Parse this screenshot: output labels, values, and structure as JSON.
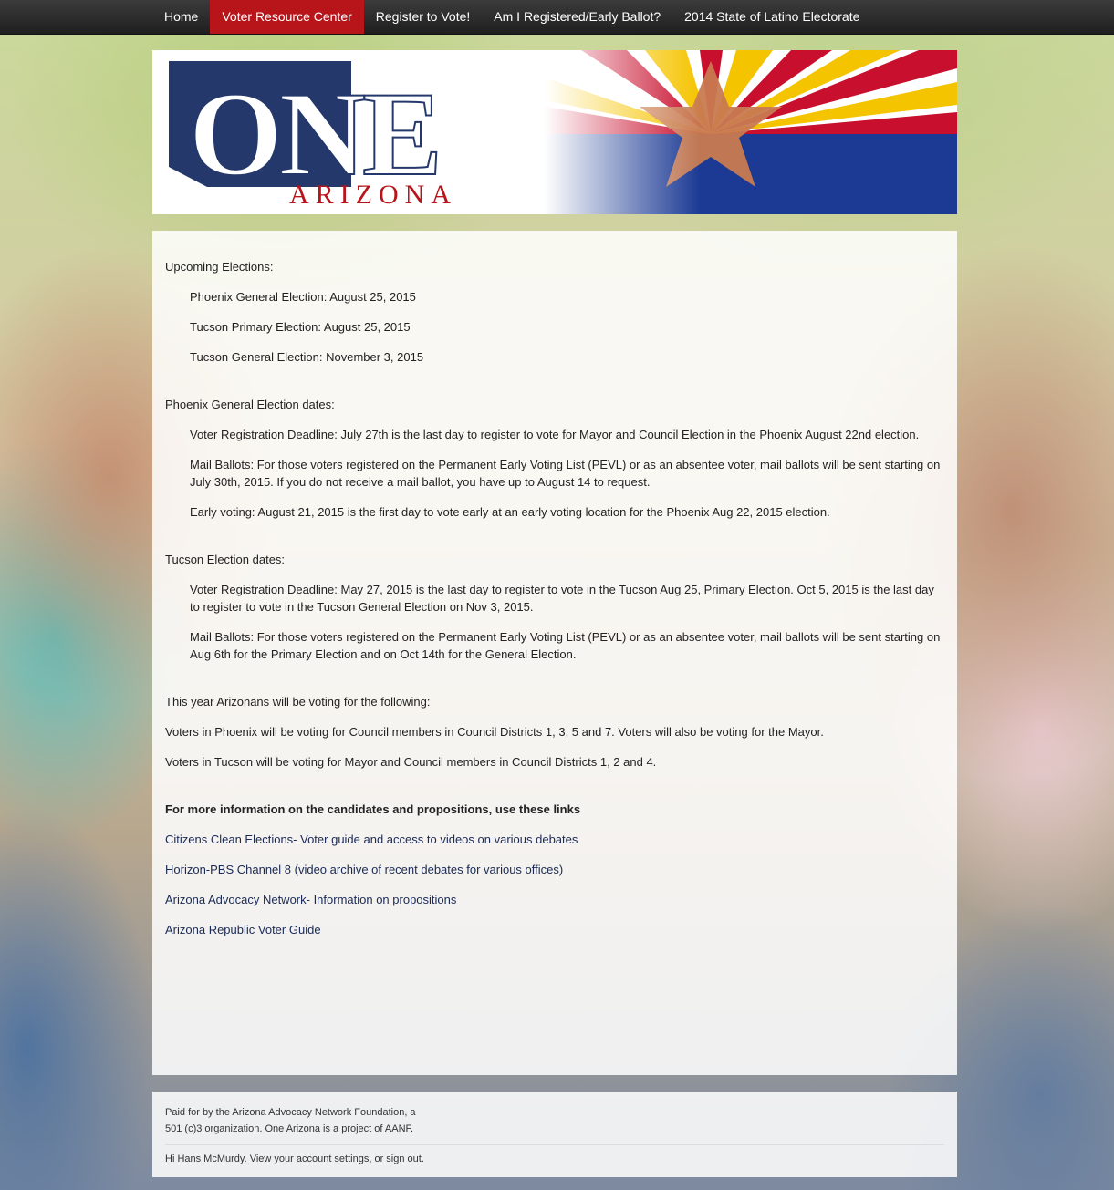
{
  "nav": {
    "items": [
      {
        "label": "Home",
        "active": false
      },
      {
        "label": "Voter Resource Center",
        "active": true
      },
      {
        "label": "Register to Vote!",
        "active": false
      },
      {
        "label": "Am I Registered/Early Ballot?",
        "active": false
      },
      {
        "label": "2014 State of Latino Electorate",
        "active": false
      }
    ],
    "active_color": "#b8151b"
  },
  "banner": {
    "logo_main": "ONE",
    "logo_sub": "ARIZONA",
    "logo_color": "#24386b",
    "sub_color": "#b8151b",
    "flag_colors": {
      "red": "#c8102e",
      "yellow": "#f5c400",
      "blue": "#1c3a94",
      "copper": "#c87a50"
    }
  },
  "content": {
    "upcoming_heading": "Upcoming Elections:",
    "upcoming": [
      "Phoenix General Election:  August 25, 2015",
      "Tucson Primary Election: August 25, 2015",
      "Tucson General Election: November 3, 2015"
    ],
    "phoenix_heading": "Phoenix General Election dates:",
    "phoenix": [
      "Voter Registration Deadline: July 27th is the last day to register to vote for Mayor and Council Election in the Phoenix August  22nd election.",
      "Mail Ballots: For those voters registered on the Permanent Early Voting List (PEVL) or as an absentee voter, mail ballots will be sent starting on July 30th, 2015.  If you do not receive a mail ballot, you have up to August 14 to request.",
      "Early voting: August 21, 2015 is the first day to vote early at an early voting location for the Phoenix Aug 22, 2015 election."
    ],
    "tucson_heading": "Tucson Election dates:",
    "tucson": [
      "Voter Registration Deadline: May 27, 2015 is the last day to register to vote in the Tucson Aug 25, Primary Election. Oct 5, 2015 is the last day to register to vote in the Tucson General Election on Nov 3, 2015.",
      "Mail Ballots: For those voters registered on the Permanent Early Voting List (PEVL) or as an absentee voter, mail ballots will be sent starting on Aug 6th for the Primary Election and on Oct 14th for the General Election."
    ],
    "this_year": "This year Arizonans will be voting for the following:",
    "phoenix_voting": "Voters in Phoenix will be voting for Council members in Council Districts 1, 3, 5 and 7.  Voters will also be voting for the Mayor.",
    "tucson_voting": "Voters in Tucson will be voting for Mayor and Council members in Council Districts 1, 2 and 4.",
    "links_heading": "For more information on the candidates and propositions, use these links",
    "links": [
      "Citizens Clean Elections- Voter guide and access to videos on various debates",
      "Horizon-PBS Channel 8 (video archive of recent debates for various offices)",
      "Arizona Advocacy Network- Information on propositions",
      "Arizona Republic Voter Guide"
    ]
  },
  "footer": {
    "line1": "Paid for by the Arizona Advocacy Network Foundation, a",
    "line2": "501 (c)3 organization. One Arizona is a project of AANF.",
    "greeting": "Hi Hans McMurdy. View your account settings, or sign out."
  }
}
